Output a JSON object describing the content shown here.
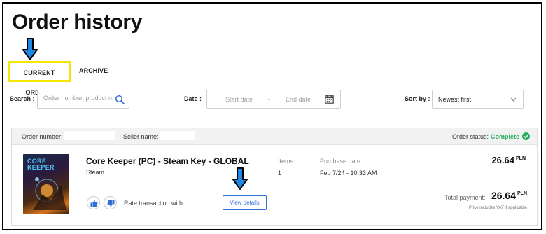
{
  "page": {
    "title": "Order history"
  },
  "tabs": {
    "current": "CURRENT ORDERS",
    "archive": "ARCHIVE"
  },
  "filters": {
    "search_label": "Search :",
    "search_placeholder": "Order number, product n...",
    "date_label": "Date :",
    "start_placeholder": "Start date",
    "separator": "~",
    "end_placeholder": "End date",
    "sort_label": "Sort by :",
    "sort_value": "Newest first"
  },
  "order": {
    "number_label": "Order number:",
    "seller_label": "Seller name:",
    "status_label": "Order status:",
    "status_value": "Complete",
    "product_title": "Core Keeper (PC) - Steam Key - GLOBAL",
    "platform": "Steam",
    "cover_logo_line1": "CORE",
    "cover_logo_line2": "KEEPER",
    "items_label": "Items:",
    "items_value": "1",
    "purchase_label": "Purchase date:",
    "purchase_value": "Feb 7/24 - 10:33 AM",
    "rate_text": "Rate transaction with",
    "view_details": "View details",
    "price": "26.64",
    "currency": "PLN",
    "total_label": "Total payment:",
    "total_value": "26.64",
    "total_currency": "PLN",
    "vat_note": "Price includes VAT if applicable"
  },
  "colors": {
    "highlight": "#f5e600",
    "arrow": "#1e88e5",
    "accent": "#2f6fd6",
    "status": "#27ae60"
  },
  "icons": [
    "arrow-down-icon",
    "search-icon",
    "calendar-icon",
    "chevron-down-icon",
    "check-circle-icon",
    "thumbs-up-icon",
    "thumbs-down-icon"
  ]
}
